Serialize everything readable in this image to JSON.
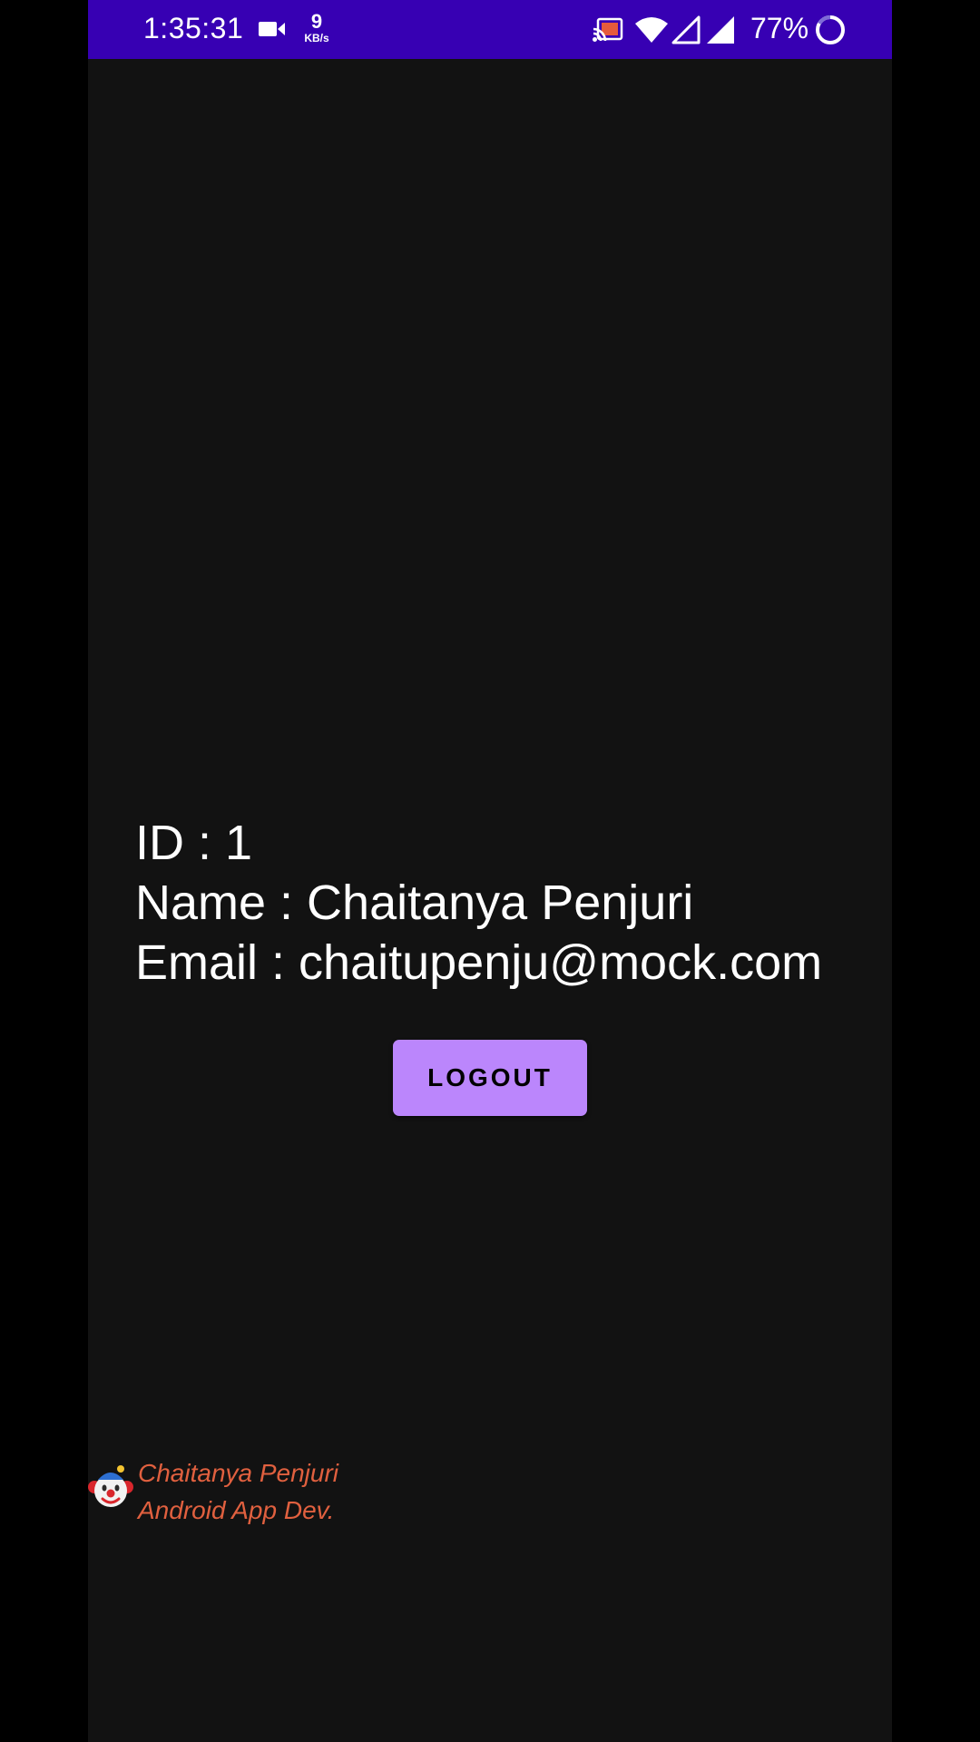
{
  "status_bar": {
    "time": "1:35:31",
    "net_speed_value": "9",
    "net_speed_unit": "KB/s",
    "battery_percent": "77%",
    "icons": [
      "video-camera-icon",
      "cast-icon",
      "wifi-icon",
      "cell-signal-icon",
      "cell-signal-icon",
      "battery-ring-icon"
    ],
    "background_color": "#3700B3"
  },
  "profile": {
    "id_line": "ID : 1",
    "name_line": "Name : Chaitanya Penjuri",
    "email_line": "Email : chaitupenju@mock.com"
  },
  "actions": {
    "logout_label": "LOGOUT",
    "logout_color": "#BB86FC"
  },
  "watermark": {
    "line1": "Chaitanya Penjuri",
    "line2": "Android App Dev.",
    "avatar_icon": "clown-face-icon",
    "text_color": "#E0603F"
  },
  "theme": {
    "background": "#121212"
  }
}
